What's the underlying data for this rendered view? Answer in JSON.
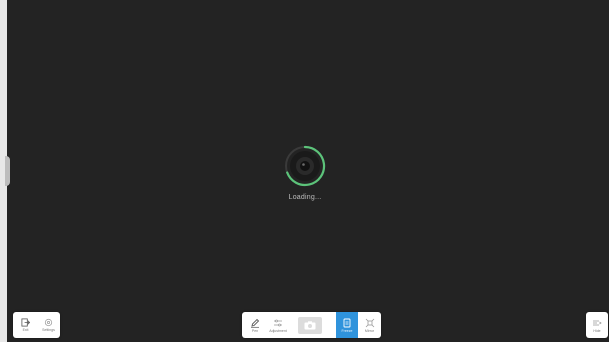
{
  "loading": {
    "text": "Loading..."
  },
  "toolbar_left": {
    "exit_label": "Exit",
    "settings_label": "Settings"
  },
  "toolbar_center": {
    "pen_label": "Pen",
    "adjust_label": "Adjustment",
    "capture_label": "",
    "freeze_label": "Freeze",
    "mirror_label": "Mirror"
  },
  "toolbar_right": {
    "menu_label": "Hide"
  },
  "colors": {
    "background": "#232323",
    "accent": "#2f93dc",
    "loader_ring": "#5cc37a"
  }
}
